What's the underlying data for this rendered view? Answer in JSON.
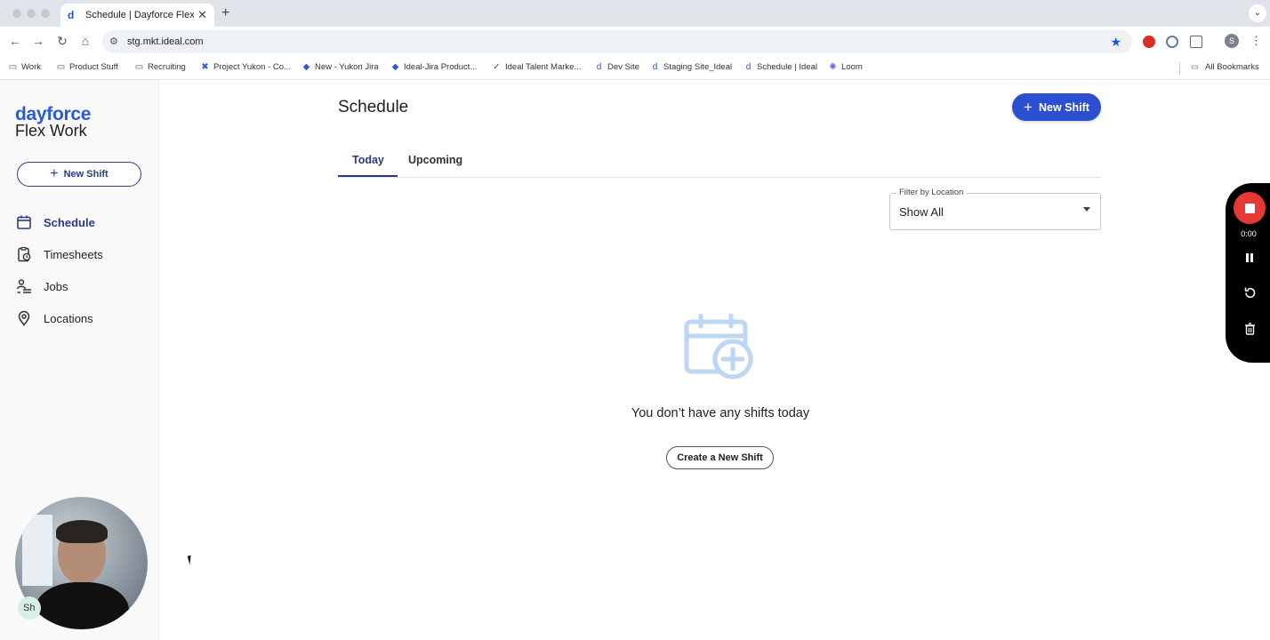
{
  "browser": {
    "tab_title": "Schedule | Dayforce Flex Work",
    "url": "stg.mkt.ideal.com",
    "profile_initial": "S",
    "bookmarks": [
      {
        "label": "Work",
        "icon": "folder-icon"
      },
      {
        "label": "Product Stuff",
        "icon": "folder-icon"
      },
      {
        "label": "Recruiting",
        "icon": "folder-icon"
      },
      {
        "label": "Project Yukon - Co...",
        "icon": "jira-icon"
      },
      {
        "label": "New - Yukon Jira",
        "icon": "jira-icon"
      },
      {
        "label": "Ideal-Jira Product...",
        "icon": "jira-icon"
      },
      {
        "label": "Ideal Talent Marke...",
        "icon": "ideal-icon"
      },
      {
        "label": "Dev Site",
        "icon": "dayforce-icon"
      },
      {
        "label": "Staging Site_Ideal",
        "icon": "dayforce-icon"
      },
      {
        "label": "Schedule | Ideal",
        "icon": "dayforce-icon"
      },
      {
        "label": "Loom",
        "icon": "loom-icon"
      }
    ],
    "all_bookmarks": "All Bookmarks"
  },
  "sidebar": {
    "logo_top": "dayforce",
    "logo_bottom": "Flex Work",
    "new_shift": "New Shift",
    "items": [
      {
        "label": "Schedule",
        "icon": "calendar-icon",
        "active": true
      },
      {
        "label": "Timesheets",
        "icon": "timesheet-icon",
        "active": false
      },
      {
        "label": "Jobs",
        "icon": "jobs-icon",
        "active": false
      },
      {
        "label": "Locations",
        "icon": "location-pin-icon",
        "active": false
      }
    ],
    "avatar_badge": "Sh"
  },
  "main": {
    "title": "Schedule",
    "new_shift": "New Shift",
    "tabs": [
      {
        "label": "Today",
        "active": true
      },
      {
        "label": "Upcoming",
        "active": false
      }
    ],
    "filter": {
      "label": "Filter by Location",
      "value": "Show All"
    },
    "empty": {
      "message": "You don’t have any shifts today",
      "button": "Create a New Shift"
    }
  },
  "recorder": {
    "time": "0:00"
  },
  "colors": {
    "brand": "#2c4fd0",
    "nav_active": "#2a3a8a",
    "record": "#e53935",
    "empty_icon": "#bcd6f4"
  }
}
